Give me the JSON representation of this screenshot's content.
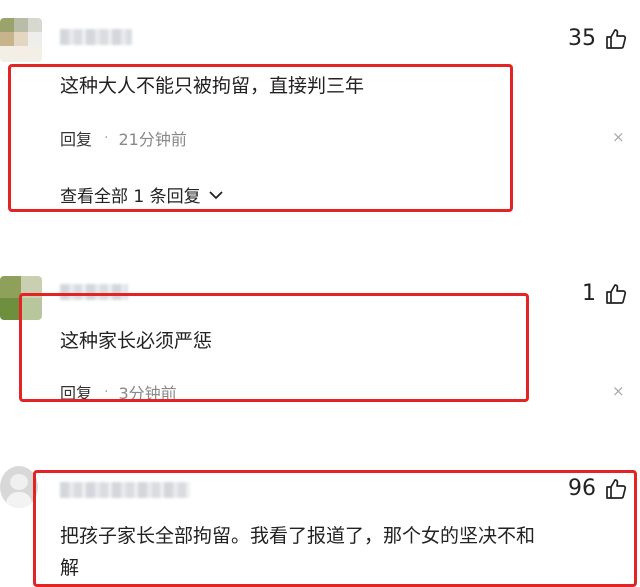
{
  "comments": [
    {
      "likes": "35",
      "text": "这种大人不能只被拘留，直接判三年",
      "reply_label": "回复",
      "separator": "·",
      "time": "21分钟前",
      "view_replies": "查看全部 1 条回复",
      "close_icon": "×"
    },
    {
      "likes": "1",
      "text": "这种家长必须严惩",
      "reply_label": "回复",
      "separator": "·",
      "time": "3分钟前",
      "close_icon": "×"
    },
    {
      "likes": "96",
      "text_line1": "把孩子家长全部拘留。我看了报道了，那个女的坚决不和",
      "text_line2": "解"
    }
  ],
  "colors": {
    "highlight": "#e22424",
    "text": "#222222",
    "muted": "#888888"
  },
  "icons": {
    "like": "thumbs-up-icon",
    "expand": "chevron-down-icon",
    "dismiss": "close-icon"
  }
}
